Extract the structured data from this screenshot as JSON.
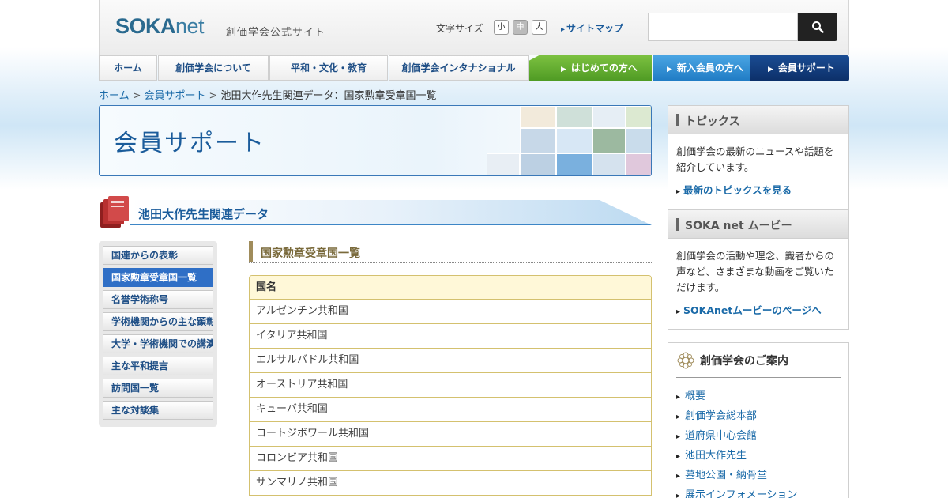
{
  "header": {
    "logo_main": "SOKA",
    "logo_net": "net",
    "logo_sub": "創価学会公式サイト",
    "font_size_label": "文字サイズ",
    "font_size_small": "小",
    "font_size_medium": "中",
    "font_size_large": "大",
    "sitemap": "サイトマップ",
    "search": {
      "placeholder": "",
      "button_icon": "search-icon"
    }
  },
  "gnav": {
    "items": [
      "ホーム",
      "創価学会について",
      "平和・文化・教育",
      "創価学会インタナショナル"
    ],
    "first_time": "はじめての方へ",
    "new_member": "新入会員の方へ",
    "member_support": "会員サポート"
  },
  "breadcrumb": {
    "home": "ホーム",
    "sep": ">",
    "support": "会員サポート",
    "current": "池田大作先生関連データ：国家勲章受章国一覧"
  },
  "hero": {
    "title": "会員サポート"
  },
  "section": {
    "title": "池田大作先生関連データ"
  },
  "side_menu": {
    "items": [
      {
        "label": "国連からの表彰",
        "active": false
      },
      {
        "label": "国家勲章受章国一覧",
        "active": true
      },
      {
        "label": "名誉学術称号",
        "active": false
      },
      {
        "label": "学術機関からの主な顕彰",
        "active": false
      },
      {
        "label": "大学・学術機関での講演",
        "active": false
      },
      {
        "label": "主な平和提言",
        "active": false
      },
      {
        "label": "訪問国一覧",
        "active": false
      },
      {
        "label": "主な対談集",
        "active": false
      }
    ]
  },
  "content": {
    "title": "国家勲章受章国一覧",
    "table": {
      "header": "国名",
      "rows": [
        "アルゼンチン共和国",
        "イタリア共和国",
        "エルサルバドル共和国",
        "オーストリア共和国",
        "キューバ共和国",
        "コートジボワール共和国",
        "コロンビア共和国",
        "サンマリノ共和国"
      ]
    }
  },
  "right": {
    "topics": {
      "title": "トピックス",
      "text": "創価学会の最新のニュースや話題を紹介しています。",
      "link": "最新のトピックスを見る"
    },
    "movie": {
      "title": "SOKA net ムービー",
      "text": "創価学会の活動や理念、識者からの声など、さまざまな動画をご覧いただけます。",
      "link": "SOKAnetムービーのページへ"
    },
    "guide": {
      "title": "創価学会のご案内",
      "items": [
        "概要",
        "創価学会総本部",
        "道府県中心会館",
        "池田大作先生",
        "墓地公園・納骨堂",
        "展示インフォメーション"
      ]
    }
  },
  "colors": {
    "accent_blue": "#1b5c9b",
    "nav_green": "#4e9a23",
    "nav_blue": "#1f7bc4",
    "nav_navy": "#0c2f68",
    "table_border": "#d4c16f",
    "table_head_bg": "#fff8d8"
  }
}
